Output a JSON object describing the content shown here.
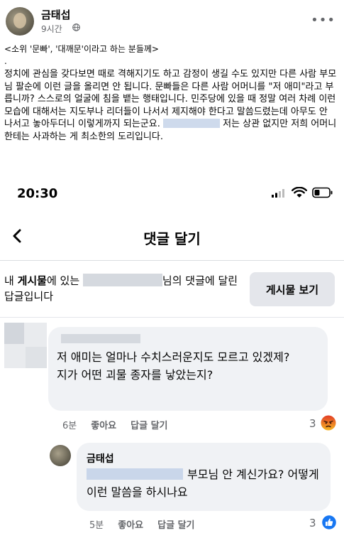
{
  "post": {
    "author": "금태섭",
    "time": "9시간",
    "subject": "<소위 '문빠', '대깨문'이라고 하는 분들께>",
    "dot": ".",
    "body_part1": "정치에 관심을 갖다보면 때로 격해지기도 하고 감정이 생길 수도 있지만 다른 사람 부모님 팔순에 이런 글을 올리면 안 됩니다. 문빠들은 다른 사람 어머니를 \"저 애미\"라고 부릅니까? 스스로의 얼굴에 침을 뱉는 행태입니다. 민주당에 있을 때 정말 여러 차례 이런 모습에 대해서는 지도부나 리더들이 나서서 제지해야 한다고 말씀드렸는데 아무도 안 나서고 놓아두더니 이렇게까지 되는군요. ",
    "body_part2": " 저는 상관 없지만 저희 어머니한테는 사과하는 게 최소한의 도리입니다."
  },
  "screenshot": {
    "status_time": "20:30",
    "nav_title": "댓글 달기",
    "context_prefix": "내 ",
    "context_bold": "게시물",
    "context_mid": "에 있는 ",
    "context_suffix": "님의 댓글에 달린 답글입니다",
    "view_post_label": "게시물 보기",
    "comment": {
      "text": "저 애미는 얼마나 수치스러운지도 모르고 있겠제?\n지가 어떤 괴물 종자를 낳았는지?",
      "time": "6분",
      "like_label": "좋아요",
      "reply_label": "답글 달기",
      "reaction_count": "3",
      "reaction_icon": "angry-emoji-icon"
    },
    "reply": {
      "author": "금태섭",
      "text": "부모님 안 계신가요? 어떻게 이런 말씀을 하시나요",
      "time": "5분",
      "like_label": "좋아요",
      "reply_label": "답글 달기",
      "reaction_count": "3",
      "reaction_icon": "like-thumb-icon"
    }
  },
  "colors": {
    "text": "#050505",
    "muted": "#65676b",
    "bubble": "#f0f2f5",
    "button": "#e4e6eb",
    "like_blue": "#1877f2",
    "angry_orange": "#e9710f"
  }
}
